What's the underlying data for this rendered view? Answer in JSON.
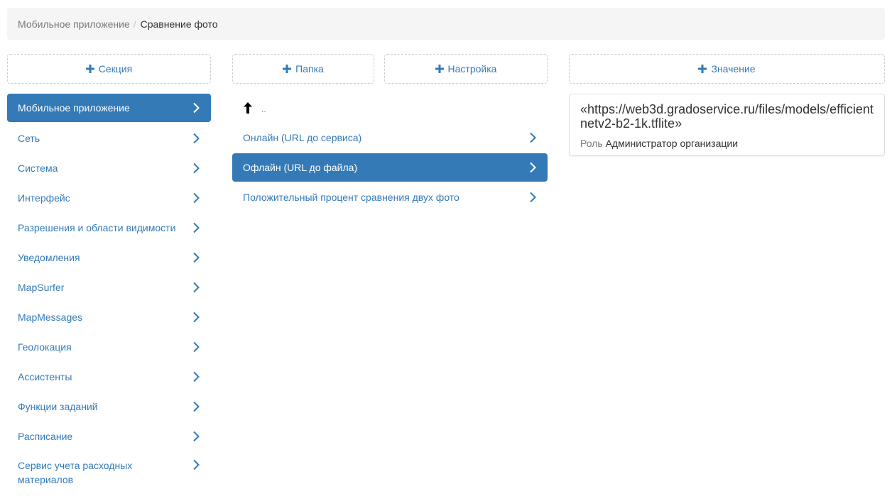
{
  "breadcrumb": {
    "parent": "Мобильное приложение",
    "separator": "/",
    "current": "Сравнение фото"
  },
  "buttons": {
    "add_section": "Секция",
    "add_folder": "Папка",
    "add_setting": "Настройка",
    "add_value": "Значение"
  },
  "sections": [
    {
      "label": "Мобильное приложение",
      "active": true
    },
    {
      "label": "Сеть"
    },
    {
      "label": "Система"
    },
    {
      "label": "Интерфейс"
    },
    {
      "label": "Разрешения и области видимости"
    },
    {
      "label": "Уведомления"
    },
    {
      "label": "MapSurfer"
    },
    {
      "label": "MapMessages"
    },
    {
      "label": "Геолокация"
    },
    {
      "label": "Ассистенты"
    },
    {
      "label": "Функции заданий"
    },
    {
      "label": "Расписание"
    },
    {
      "label": "Сервис учета расходных материалов"
    }
  ],
  "folders": {
    "up_label": "..",
    "items": [
      {
        "label": "Онлайн (URL до сервиса)"
      },
      {
        "label": "Офлайн (URL до файла)",
        "active": true
      },
      {
        "label": "Положительный процент сравнения двух фото"
      }
    ]
  },
  "value": {
    "text": "«https://web3d.gradoservice.ru/files/models/efficientnetv2-b2-1k.tflite»",
    "role_label": "Роль",
    "role_value": "Администратор организации"
  },
  "colors": {
    "accent": "#337ab7",
    "breadcrumb_bg": "#f5f5f5",
    "muted": "#777777"
  }
}
